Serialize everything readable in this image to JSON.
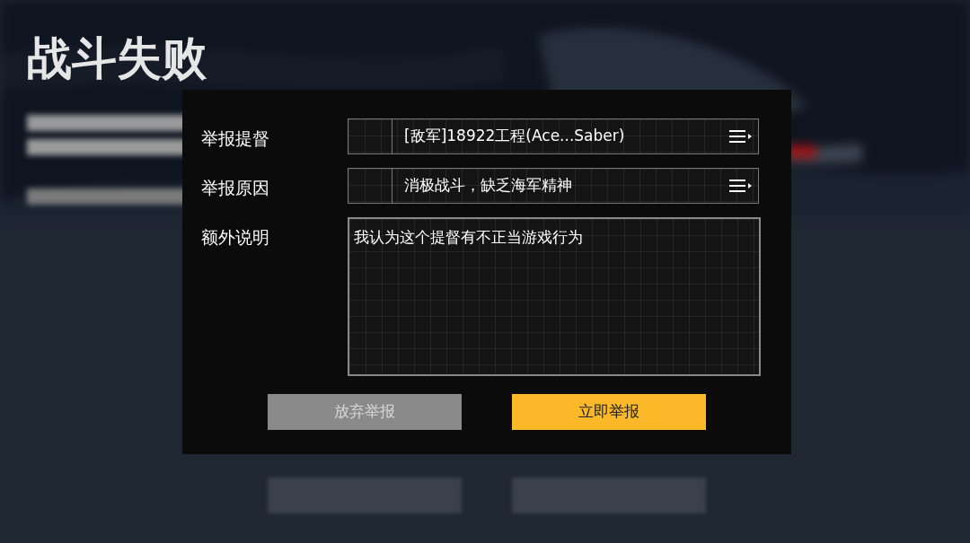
{
  "background": {
    "title": "战斗失败"
  },
  "report_dialog": {
    "fields": [
      {
        "kind": "select",
        "label": "举报提督",
        "value": "[敌军]18922工程(Ace...Saber)"
      },
      {
        "kind": "select",
        "label": "举报原因",
        "value": "消极战斗，缺乏海军精神"
      },
      {
        "kind": "textarea",
        "label": "额外说明",
        "value": "我认为这个提督有不正当游戏行为"
      }
    ],
    "buttons": [
      {
        "kind": "secondary",
        "label": "放弃举报"
      },
      {
        "kind": "primary",
        "label": "立即举报"
      }
    ]
  }
}
